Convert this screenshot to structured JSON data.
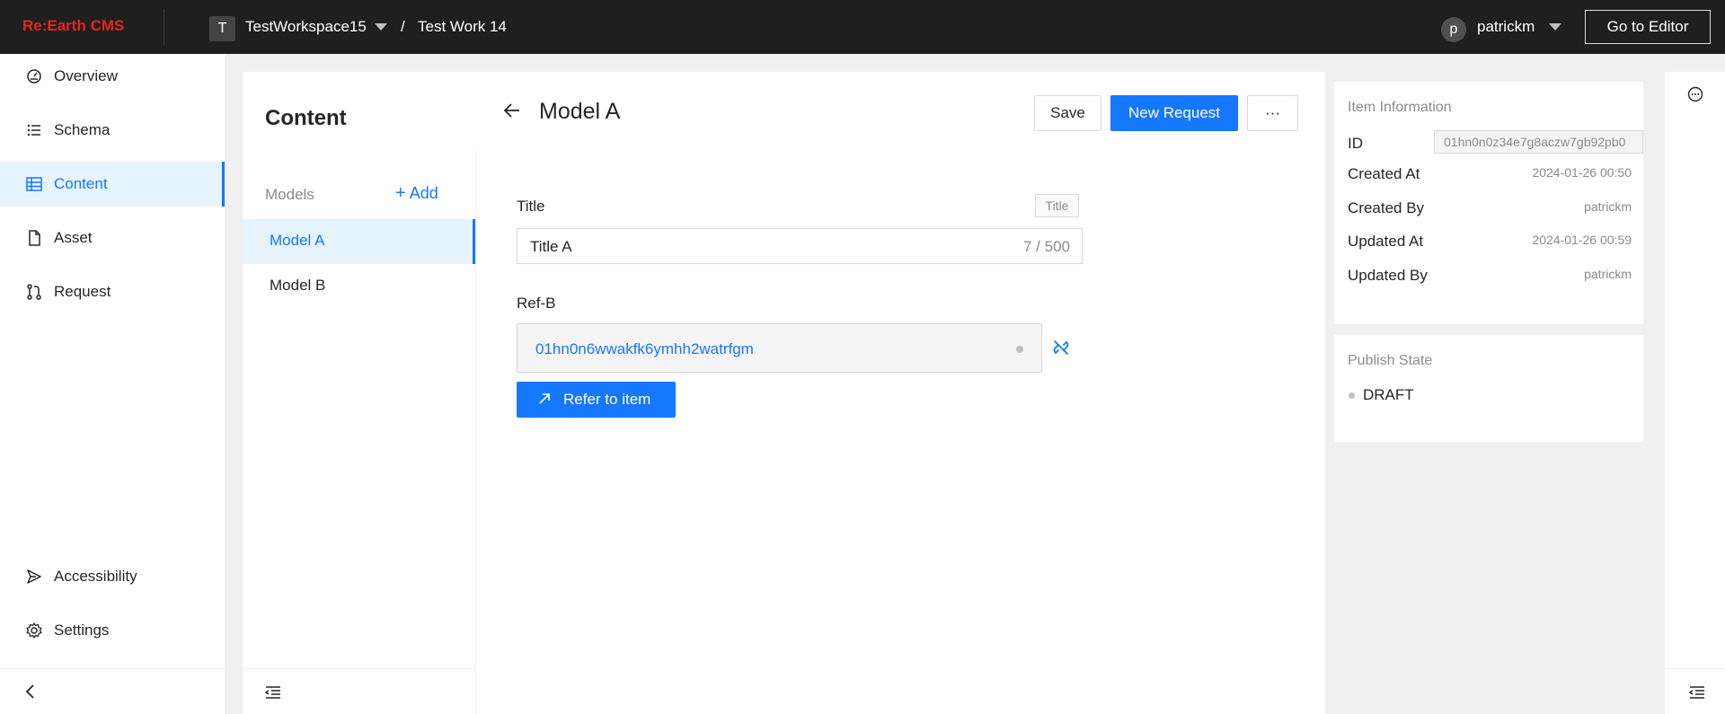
{
  "header": {
    "logo": "Re:Earth CMS",
    "workspace_initial": "T",
    "workspace_name": "TestWorkspace15",
    "separator": "/",
    "project_name": "Test Work 14",
    "user_initial": "p",
    "user_name": "patrickm",
    "go_to_editor": "Go to Editor"
  },
  "sidebar": {
    "items": [
      {
        "label": "Overview",
        "icon": "dashboard-icon"
      },
      {
        "label": "Schema",
        "icon": "list-icon"
      },
      {
        "label": "Content",
        "icon": "table-icon",
        "active": true
      },
      {
        "label": "Asset",
        "icon": "file-icon"
      },
      {
        "label": "Request",
        "icon": "pull-request-icon"
      }
    ],
    "bottom_items": [
      {
        "label": "Accessibility",
        "icon": "send-icon"
      },
      {
        "label": "Settings",
        "icon": "gear-icon"
      }
    ]
  },
  "content_panel": {
    "title": "Content",
    "models_label": "Models",
    "add_label": "Add",
    "models": [
      {
        "label": "Model A",
        "active": true
      },
      {
        "label": "Model B",
        "active": false
      }
    ]
  },
  "editor": {
    "title": "Model A",
    "save_label": "Save",
    "new_request_label": "New Request",
    "more_label": "···",
    "fields": {
      "title": {
        "label": "Title",
        "tag": "Title",
        "value": "Title A",
        "count": "7 / 500"
      },
      "ref_b": {
        "label": "Ref-B",
        "value": "01hn0n6wwakfk6ymhh2watrfgm",
        "refer_label": "Refer to item"
      }
    }
  },
  "item_info": {
    "header": "Item Information",
    "id_label": "ID",
    "id_value": "01hn0n0z34e7g8aczw7gb92pb0",
    "created_at_label": "Created At",
    "created_at": "2024-01-26 00:50",
    "created_by_label": "Created By",
    "created_by": "patrickm",
    "updated_at_label": "Updated At",
    "updated_at": "2024-01-26 00:59",
    "updated_by_label": "Updated By",
    "updated_by": "patrickm"
  },
  "publish_state": {
    "header": "Publish State",
    "value": "DRAFT"
  },
  "colors": {
    "accent": "#1677ff",
    "header_bg": "#1f1f1f",
    "logo": "#e3261f",
    "active_bg": "#e6f4ff"
  }
}
